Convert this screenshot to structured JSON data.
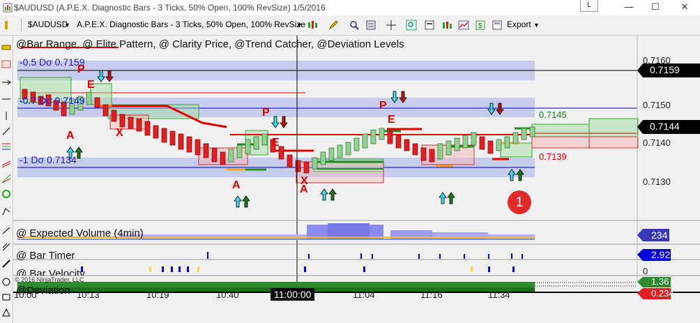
{
  "window": {
    "title": "$AUDUSD (A.P.E.X. Diagnostic Bars - 3 Ticks, 50% Open, 100% RevSize)  1/5/2016",
    "layout_button": "L",
    "minimize": "—",
    "maximize": "☐",
    "close": "✕"
  },
  "toolbar": {
    "instrument": "$AUDUSD",
    "bar_type": "A.P.E.X. Diagnostic Bars - 3 Ticks, 50% Open, 100% RevSize",
    "export_label": "Export"
  },
  "chart": {
    "indicators_label": "@Bar Range, @ Elite Pattern, @ Clarity Price, @Trend Catcher, @Deviation Levels",
    "dev_levels": [
      {
        "label": "-0.5 Dσ 0.7159"
      },
      {
        "label": "-0.7 Dσ 0.7149"
      },
      {
        "label": "-1 Dσ 0.7134"
      }
    ],
    "price_ticks": [
      "0.7160",
      "0.7150",
      "0.7140",
      "0.7130"
    ],
    "price_tags": {
      "upper": "0.7159",
      "current": "0.7144"
    },
    "levels": {
      "green": "0.7145",
      "red": "0.7139"
    },
    "pattern_letters": [
      "P",
      "E",
      "A",
      "X",
      "P",
      "E",
      "A",
      "X",
      "A",
      "P",
      "E"
    ],
    "callout": "1"
  },
  "panels": {
    "expected_volume": {
      "label": "@ Expected Volume (4min)",
      "value": "234"
    },
    "bar_timer": {
      "label": "@ Bar Timer",
      "value": "2.92"
    },
    "bar_velocity": {
      "label": "@ Bar Velocity",
      "value": "0"
    },
    "deviation": {
      "label": "@Deviation",
      "values": [
        "1.36",
        "0.234"
      ]
    }
  },
  "time_axis": {
    "ticks": [
      "10:00",
      "10:13",
      "10:19",
      "10:40",
      "11:04",
      "11:16",
      "11:34"
    ],
    "crosshair_time": "11:00:00"
  },
  "copyright": "© 2016 NinjaTrader, LLC",
  "colors": {
    "up_bar": "#8fd18f",
    "down_bar": "#e02020",
    "deviation_band": "#b8bce6",
    "trend_line": "#e00000",
    "accent_blue": "#0000e0",
    "volume_bar": "#8c8cf0"
  }
}
